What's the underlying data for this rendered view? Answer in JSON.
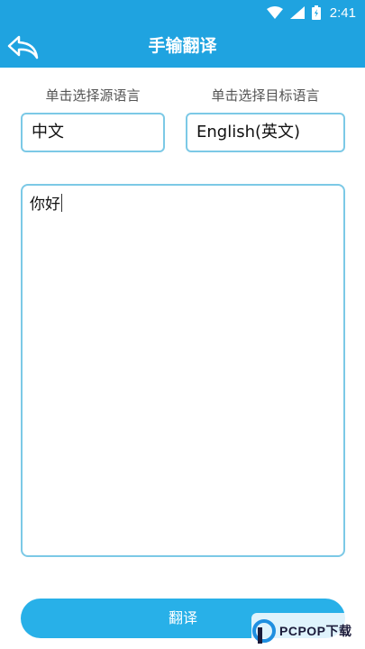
{
  "status_bar": {
    "time": "2:41",
    "icons": [
      "wifi-icon",
      "signal-icon",
      "battery-icon"
    ]
  },
  "app_bar": {
    "title": "手输翻译",
    "back_icon": "back-arrow-icon"
  },
  "source_language": {
    "label": "单击选择源语言",
    "value": "中文"
  },
  "target_language": {
    "label": "单击选择目标语言",
    "value": "English(英文)"
  },
  "input": {
    "text": "你好"
  },
  "translate_button": {
    "label": "翻译"
  },
  "watermark": {
    "text": "PCPOP下载"
  },
  "colors": {
    "primary": "#1fa3e0",
    "button": "#28b0e8",
    "border": "#7cc9e6"
  }
}
